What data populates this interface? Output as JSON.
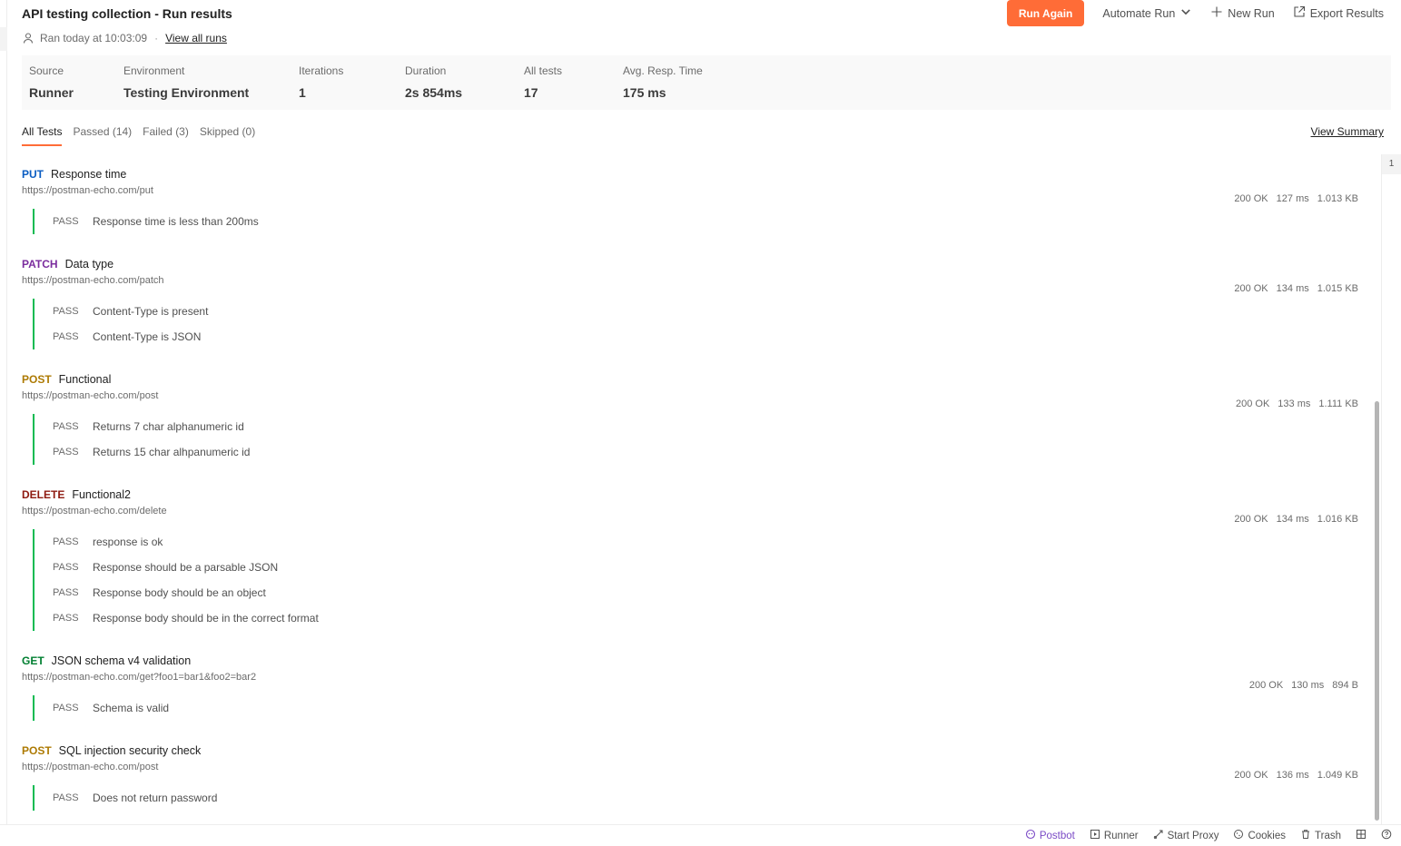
{
  "header": {
    "title": "API testing collection - Run results",
    "ran_text": "Ran today at 10:03:09",
    "separator": "·",
    "view_all_runs": "View all runs"
  },
  "actions": {
    "run_again": "Run Again",
    "automate_run": "Automate Run",
    "new_run": "New Run",
    "export_results": "Export Results"
  },
  "summary": [
    {
      "label": "Source",
      "value": "Runner"
    },
    {
      "label": "Environment",
      "value": "Testing Environment"
    },
    {
      "label": "Iterations",
      "value": "1"
    },
    {
      "label": "Duration",
      "value": "2s 854ms"
    },
    {
      "label": "All tests",
      "value": "17"
    },
    {
      "label": "Avg. Resp. Time",
      "value": "175 ms"
    }
  ],
  "tabs": [
    {
      "label": "All Tests",
      "active": true
    },
    {
      "label": "Passed (14)"
    },
    {
      "label": "Failed (3)"
    },
    {
      "label": "Skipped (0)"
    }
  ],
  "view_summary": "View Summary",
  "colors": {
    "accent": "#ff6c37",
    "pass_bar": "#0cbb52",
    "put": "#0b5dc2",
    "patch": "#7b2d9e",
    "post": "#ad7a03",
    "delete": "#8e1a10",
    "get": "#007f31"
  },
  "requests": [
    {
      "method": "PUT",
      "name": "Response time",
      "url": "https://postman-echo.com/put",
      "status": "200 OK",
      "time": "127 ms",
      "size": "1.013 KB",
      "tests": [
        {
          "status": "PASS",
          "name": "Response time is less than 200ms"
        }
      ]
    },
    {
      "method": "PATCH",
      "name": "Data type",
      "url": "https://postman-echo.com/patch",
      "status": "200 OK",
      "time": "134 ms",
      "size": "1.015 KB",
      "tests": [
        {
          "status": "PASS",
          "name": "Content-Type is present"
        },
        {
          "status": "PASS",
          "name": "Content-Type is JSON"
        }
      ]
    },
    {
      "method": "POST",
      "name": "Functional",
      "url": "https://postman-echo.com/post",
      "status": "200 OK",
      "time": "133 ms",
      "size": "1.111 KB",
      "tests": [
        {
          "status": "PASS",
          "name": "Returns 7 char alphanumeric id"
        },
        {
          "status": "PASS",
          "name": "Returns 15 char alhpanumeric id"
        }
      ]
    },
    {
      "method": "DELETE",
      "name": "Functional2",
      "url": "https://postman-echo.com/delete",
      "status": "200 OK",
      "time": "134 ms",
      "size": "1.016 KB",
      "tests": [
        {
          "status": "PASS",
          "name": "response is ok"
        },
        {
          "status": "PASS",
          "name": "Response should be a parsable JSON"
        },
        {
          "status": "PASS",
          "name": "Response body should be an object"
        },
        {
          "status": "PASS",
          "name": "Response body should be in the correct format"
        }
      ]
    },
    {
      "method": "GET",
      "name": "JSON schema v4 validation",
      "url": "https://postman-echo.com/get?foo1=bar1&foo2=bar2",
      "status": "200 OK",
      "time": "130 ms",
      "size": "894 B",
      "tests": [
        {
          "status": "PASS",
          "name": "Schema is valid"
        }
      ]
    },
    {
      "method": "POST",
      "name": "SQL injection security check",
      "url": "https://postman-echo.com/post",
      "status": "200 OK",
      "time": "136 ms",
      "size": "1.049 KB",
      "tests": [
        {
          "status": "PASS",
          "name": "Does not return password"
        }
      ]
    }
  ],
  "page_indicator": "1",
  "statusbar": {
    "postbot": "Postbot",
    "runner": "Runner",
    "start_proxy": "Start Proxy",
    "cookies": "Cookies",
    "trash": "Trash"
  }
}
